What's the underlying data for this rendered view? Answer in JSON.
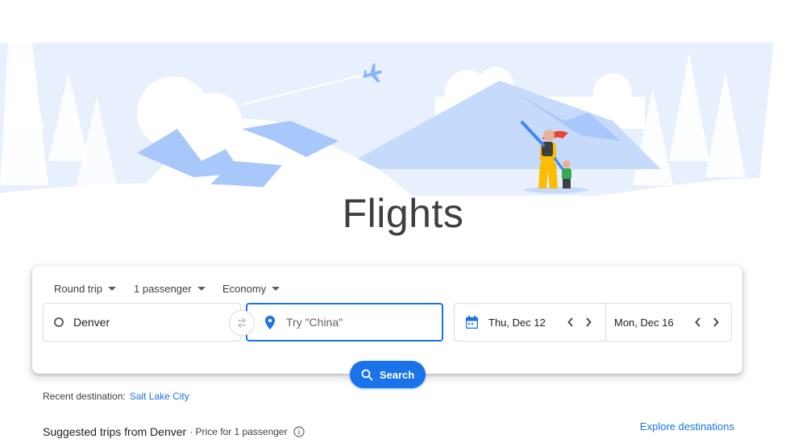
{
  "hero": {
    "title": "Flights"
  },
  "search_card": {
    "trip_type": "Round trip",
    "passengers": "1 passenger",
    "cabin_class": "Economy",
    "from_value": "Denver",
    "to_placeholder": "Try \"China\"",
    "depart_date": "Thu, Dec 12",
    "return_date": "Mon, Dec 16",
    "search_label": "Search"
  },
  "recent": {
    "label": "Recent destination:",
    "city": "Salt Lake City"
  },
  "suggested": {
    "title": "Suggested trips from Denver",
    "subtitle": "· Price for 1 passenger"
  },
  "explore_label": "Explore destinations",
  "colors": {
    "accent": "#1a73e8",
    "text": "#3c4043",
    "border": "#dadce0",
    "hero_blue": "#a8c7fa"
  }
}
